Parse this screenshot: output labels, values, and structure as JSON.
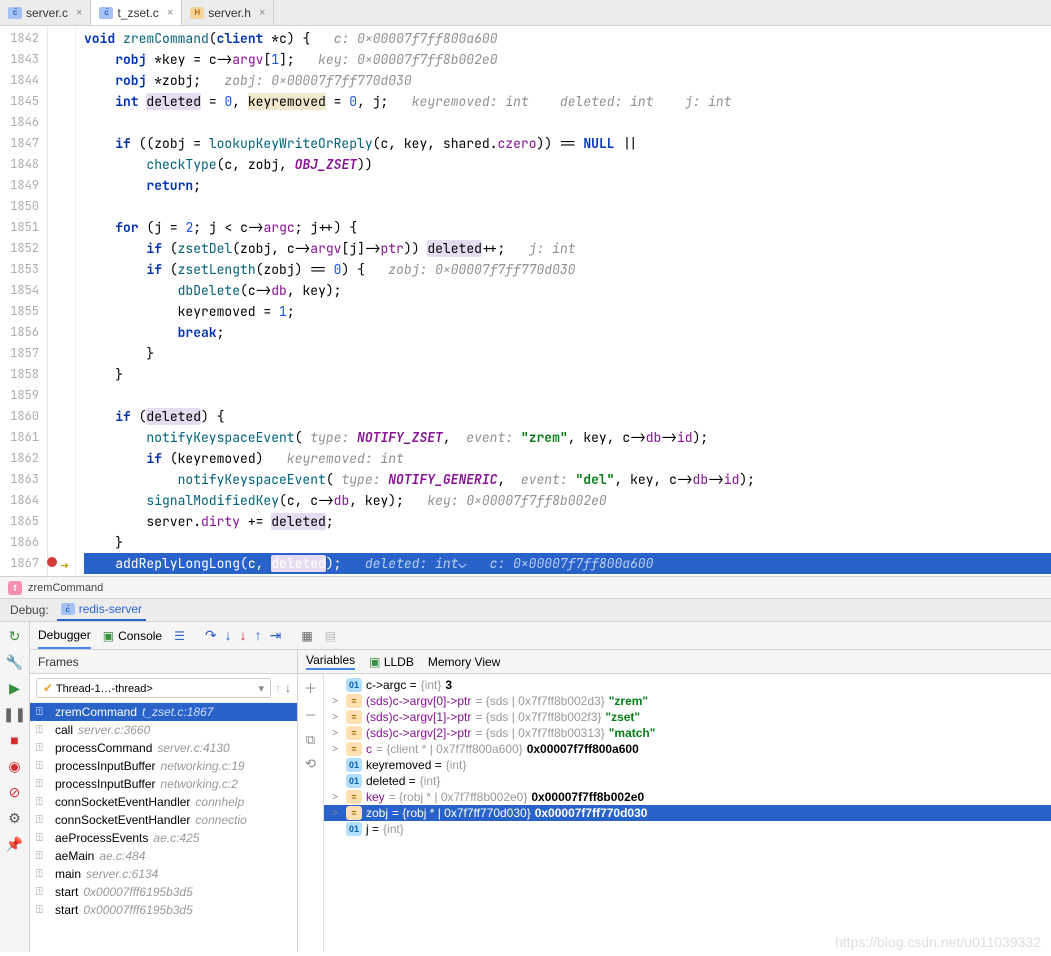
{
  "tabs": [
    {
      "icon": "c",
      "label": "server.c",
      "active": false
    },
    {
      "icon": "c",
      "label": "t_zset.c",
      "active": true
    },
    {
      "icon": "h",
      "label": "server.h",
      "active": false
    }
  ],
  "lines_start": 1842,
  "breakpoint_line": 1867,
  "breadcrumb": "zremCommand",
  "debug": {
    "label": "Debug:",
    "config": "redis-server",
    "tabs": {
      "debugger": "Debugger",
      "console": "Console"
    },
    "frames_title": "Frames",
    "thread": "Thread-1…-thread>",
    "frames": [
      {
        "name": "zremCommand",
        "loc": "t_zset.c:1867",
        "sel": true
      },
      {
        "name": "call",
        "loc": "server.c:3660"
      },
      {
        "name": "processCommand",
        "loc": "server.c:4130"
      },
      {
        "name": "processInputBuffer",
        "loc": "networking.c:19"
      },
      {
        "name": "processInputBuffer",
        "loc": "networking.c:2"
      },
      {
        "name": "connSocketEventHandler",
        "loc": "connhelp"
      },
      {
        "name": "connSocketEventHandler",
        "loc": "connectio"
      },
      {
        "name": "aeProcessEvents",
        "loc": "ae.c:425"
      },
      {
        "name": "aeMain",
        "loc": "ae.c:484"
      },
      {
        "name": "main",
        "loc": "server.c:6134"
      },
      {
        "name": "start",
        "loc": "0x00007fff6195b3d5"
      },
      {
        "name": "start",
        "loc": "0x00007fff6195b3d5"
      }
    ],
    "var_tabs": {
      "variables": "Variables",
      "lldb": "LLDB",
      "memory": "Memory View"
    },
    "vars": [
      {
        "badge": "oi",
        "label": "01",
        "text_pre": "c->argc = ",
        "type": "{int} ",
        "val": "3"
      },
      {
        "tw": ">",
        "badge": "eq",
        "label": "=",
        "name": "(sds)c->argv[0]->ptr",
        "type": " = {sds | 0x7f7ff8b002d3} ",
        "str": "\"zrem\""
      },
      {
        "tw": ">",
        "badge": "eq",
        "label": "=",
        "name": "(sds)c->argv[1]->ptr",
        "type": " = {sds | 0x7f7ff8b002f3} ",
        "str": "\"zset\""
      },
      {
        "tw": ">",
        "badge": "eq",
        "label": "=",
        "name": "(sds)c->argv[2]->ptr",
        "type": " = {sds | 0x7f7ff8b00313} ",
        "str": "\"match\""
      },
      {
        "tw": ">",
        "badge": "eq",
        "label": "=",
        "name": "c",
        "type": " = {client * | 0x7f7ff800a600} ",
        "val": "0x00007f7ff800a600"
      },
      {
        "badge": "oi",
        "label": "01",
        "text_pre": "keyremoved = ",
        "type": "{int}"
      },
      {
        "badge": "oi",
        "label": "01",
        "text_pre": "deleted = ",
        "type": "{int}"
      },
      {
        "tw": ">",
        "badge": "eq",
        "label": "=",
        "name": "key",
        "type": " = {robj * | 0x7f7ff8b002e0} ",
        "val": "0x00007f7ff8b002e0"
      },
      {
        "tw": ">",
        "badge": "eq",
        "label": "=",
        "name": "zobj",
        "type": " = {robj * | 0x7f7ff770d030} ",
        "val": "0x00007f7ff770d030",
        "sel": true
      },
      {
        "badge": "oi",
        "label": "01",
        "text_pre": "j = ",
        "type": "{int}"
      }
    ]
  },
  "watermark": "https://blog.csdn.net/u011039332"
}
